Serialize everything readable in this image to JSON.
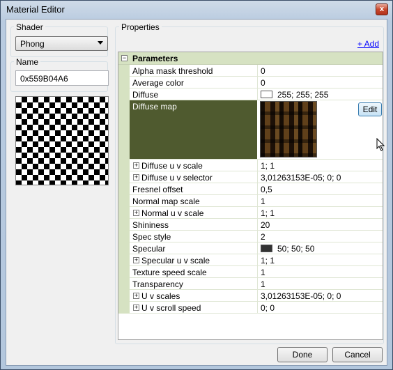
{
  "window": {
    "title": "Material Editor",
    "close_glyph": "x"
  },
  "left": {
    "shader_label": "Shader",
    "shader_value": "Phong",
    "name_label": "Name",
    "name_value": "0x559B04A6"
  },
  "properties": {
    "group_label": "Properties",
    "add_link": "+ Add",
    "category": "Parameters",
    "expander_collapse": "−",
    "expander_expand": "+",
    "rows": [
      {
        "name": "Alpha mask threshold",
        "value": "0"
      },
      {
        "name": "Average color",
        "value": "0"
      },
      {
        "name": "Diffuse",
        "value": "255; 255; 255",
        "swatch": "#ffffff"
      },
      {
        "name": "Diffuse map",
        "value": "",
        "edit_label": "Edit"
      },
      {
        "name": "Diffuse u v scale",
        "value": "1; 1",
        "expandable": true
      },
      {
        "name": "Diffuse u v selector",
        "value": "3,01263153E-05; 0; 0",
        "expandable": true
      },
      {
        "name": "Fresnel offset",
        "value": "0,5"
      },
      {
        "name": "Normal map scale",
        "value": "1"
      },
      {
        "name": "Normal u v scale",
        "value": "1; 1",
        "expandable": true
      },
      {
        "name": "Shininess",
        "value": "20"
      },
      {
        "name": "Spec style",
        "value": "2"
      },
      {
        "name": "Specular",
        "value": "50; 50; 50",
        "swatch": "#323232"
      },
      {
        "name": "Specular u v scale",
        "value": "1; 1",
        "expandable": true
      },
      {
        "name": "Texture speed scale",
        "value": "1"
      },
      {
        "name": "Transparency",
        "value": "1"
      },
      {
        "name": "U v scales",
        "value": "3,01263153E-05; 0; 0",
        "expandable": true
      },
      {
        "name": "U v scroll speed",
        "value": "0; 0",
        "expandable": true
      }
    ]
  },
  "buttons": {
    "done": "Done",
    "cancel": "Cancel"
  },
  "colors": {
    "selection": "#4f5a2f",
    "category_bg": "#d6e2c2",
    "link": "#0000ff"
  }
}
